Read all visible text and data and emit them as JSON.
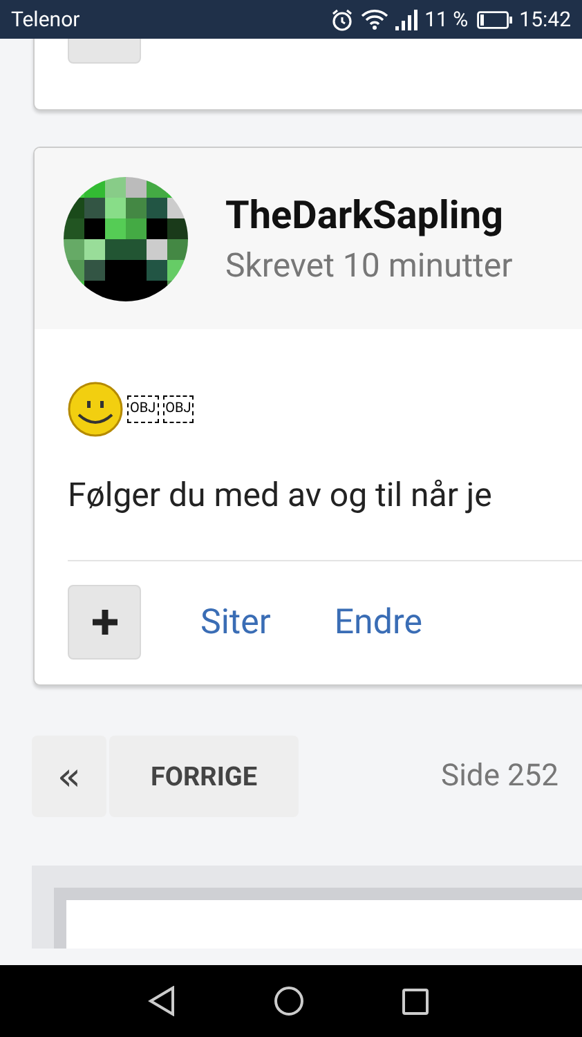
{
  "status_bar": {
    "carrier": "Telenor",
    "battery": "11 %",
    "time": "15:42"
  },
  "post": {
    "author": "TheDarkSapling",
    "meta": "Skrevet 10 minutter",
    "objects": [
      "OBJ",
      "OBJ"
    ],
    "text": "Følger du med av og til når je",
    "actions": [
      "Siter",
      "Endre"
    ]
  },
  "pagination": {
    "prev_icon": "«",
    "prev_label": "FORRIGE",
    "page": "Side 252"
  }
}
